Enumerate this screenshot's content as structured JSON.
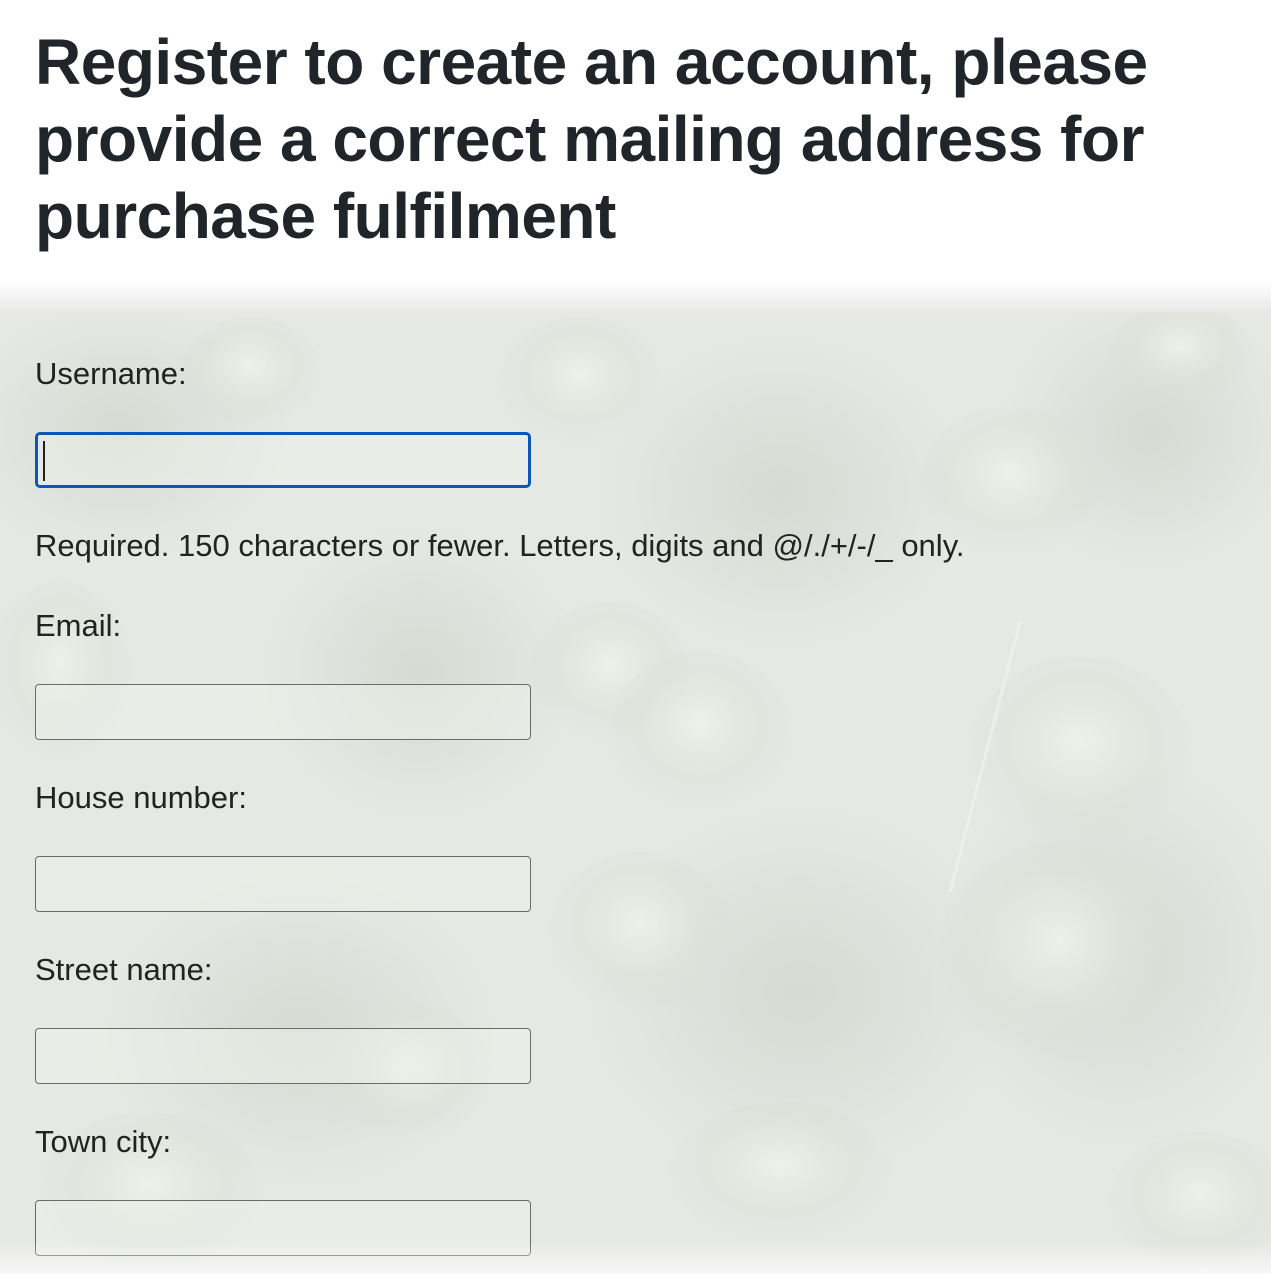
{
  "page": {
    "title": "Register to create an account, please provide a correct mailing address for purchase fulfilment"
  },
  "form": {
    "username": {
      "label": "Username:",
      "value": "",
      "help_text": "Required. 150 characters or fewer. Letters, digits and @/./+/-/_ only.",
      "focused": true
    },
    "email": {
      "label": "Email:",
      "value": ""
    },
    "house_number": {
      "label": "House number:",
      "value": ""
    },
    "street_name": {
      "label": "Street name:",
      "value": ""
    },
    "town_city": {
      "label": "Town city:",
      "value": ""
    }
  },
  "colors": {
    "focus_border": "#0b57b8",
    "title_text": "#212529",
    "background_tint": "#e5e7e3"
  }
}
